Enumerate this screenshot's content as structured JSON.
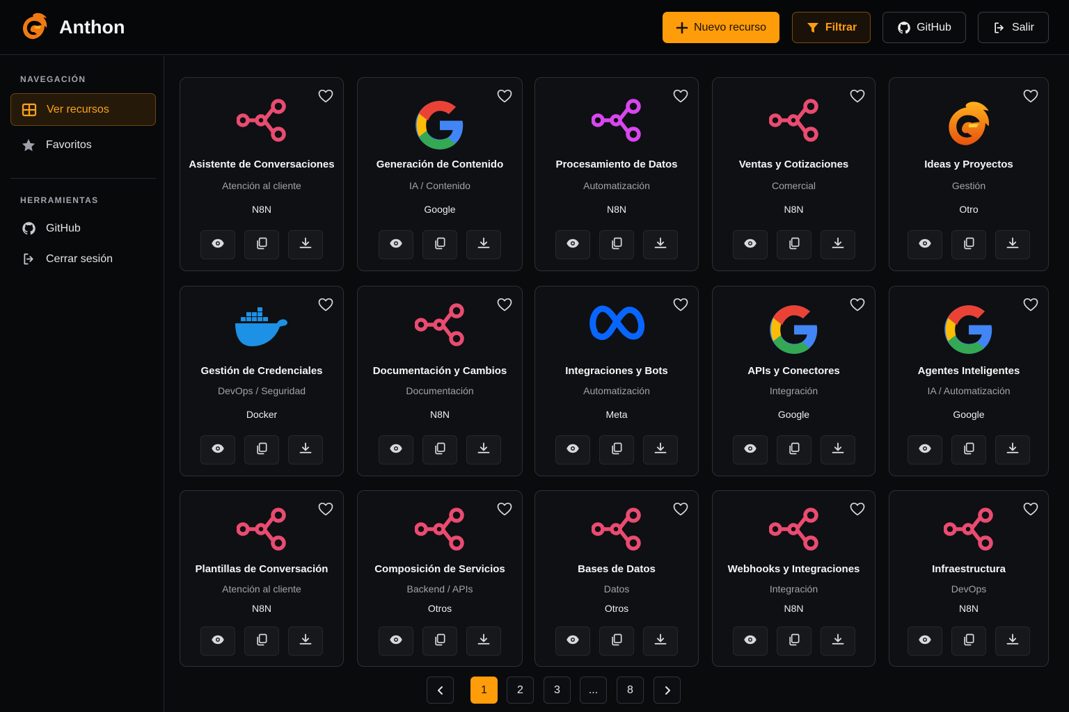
{
  "app": {
    "title": "Anthon"
  },
  "header": {
    "new_label": "Nuevo recurso",
    "filter_label": "Filtrar",
    "github_label": "GitHub",
    "exit_label": "Salir"
  },
  "sidebar": {
    "nav_title": "NAVEGACIÓN",
    "nav_items": [
      {
        "label": "Ver recursos",
        "icon": "grid-icon",
        "active": true
      },
      {
        "label": "Favoritos",
        "icon": "star-icon",
        "active": false
      }
    ],
    "tools_title": "HERRAMIENTAS",
    "tool_items": [
      {
        "label": "GitHub",
        "icon": "github-icon"
      },
      {
        "label": "Cerrar sesión",
        "icon": "logout-icon"
      }
    ]
  },
  "cards": [
    {
      "title": "Asistente de Conversaciones",
      "category": "Atención al cliente",
      "provider": "N8N",
      "icon": "n8n-icon"
    },
    {
      "title": "Generación de Contenido",
      "category": "IA / Contenido",
      "provider": "Google",
      "icon": "google-icon"
    },
    {
      "title": "Procesamiento de Datos",
      "category": "Automatización",
      "provider": "N8N",
      "icon": "n8n-icon"
    },
    {
      "title": "Ventas y Cotizaciones",
      "category": "Comercial",
      "provider": "N8N",
      "icon": "n8n-icon"
    },
    {
      "title": "Ideas y Proyectos",
      "category": "Gestión",
      "provider": "Otro",
      "icon": "anthon-logo-icon"
    },
    {
      "title": "Gestión de Credenciales",
      "category": "DevOps / Seguridad",
      "provider": "Docker",
      "icon": "docker-icon"
    },
    {
      "title": "Documentación y Cambios",
      "category": "Documentación",
      "provider": "N8N",
      "icon": "n8n-icon"
    },
    {
      "title": "Integraciones y Bots",
      "category": "Automatización",
      "provider": "Meta",
      "icon": "meta-icon"
    },
    {
      "title": "APIs y Conectores",
      "category": "Integración",
      "provider": "Google",
      "icon": "google-icon"
    },
    {
      "title": "Agentes Inteligentes",
      "category": "IA / Automatización",
      "provider": "Google",
      "icon": "google-icon"
    },
    {
      "title": "Plantillas de Conversación",
      "category": "Atención al cliente",
      "provider": "N8N",
      "icon": "n8n-icon"
    },
    {
      "title": "Composición de Servicios",
      "category": "Backend / APIs",
      "provider": "Otros",
      "icon": "n8n-icon"
    },
    {
      "title": "Bases de Datos",
      "category": "Datos",
      "provider": "Otros",
      "icon": "n8n-icon"
    },
    {
      "title": "Webhooks y Integraciones",
      "category": "Integración",
      "provider": "N8N",
      "icon": "n8n-icon"
    },
    {
      "title": "Infraestructura",
      "category": "DevOps",
      "provider": "N8N",
      "icon": "n8n-icon"
    }
  ],
  "pagination": {
    "prev": "‹",
    "pages": [
      "1",
      "2",
      "3",
      "...",
      "8"
    ],
    "current": "1",
    "next": "›"
  },
  "colors": {
    "accent": "#ff9c0a",
    "n8n": "#ea4b71",
    "n8n_alt": "#d946ef",
    "background": "#0a0b0d"
  }
}
